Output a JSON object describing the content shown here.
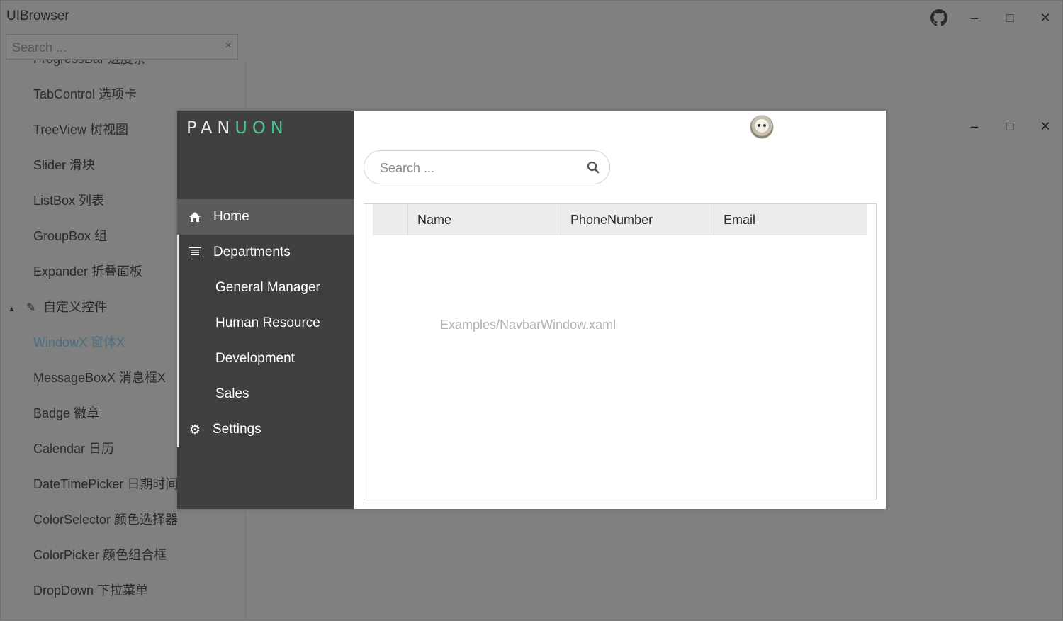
{
  "app": {
    "title": "UIBrowser",
    "controls": {
      "minimize": "–",
      "maximize": "□",
      "close": "✕"
    }
  },
  "sidebar": {
    "search_placeholder": "Search ...",
    "clear": "×",
    "items": [
      {
        "label": "TabControl 选项卡"
      },
      {
        "label": "TreeView 树视图"
      },
      {
        "label": "Slider 滑块"
      },
      {
        "label": "ListBox 列表"
      },
      {
        "label": "GroupBox 组"
      },
      {
        "label": "Expander 折叠面板"
      }
    ],
    "group": {
      "label": "自定义控件",
      "expander": "◢",
      "icon": "pencil-icon"
    },
    "group_items": [
      {
        "label": "WindowX 窗体X",
        "active": true
      },
      {
        "label": "MessageBoxX 消息框X"
      },
      {
        "label": "Badge 徽章"
      },
      {
        "label": "Calendar 日历"
      },
      {
        "label": "DateTimePicker 日期时间"
      },
      {
        "label": "ColorSelector 颜色选择器"
      },
      {
        "label": "ColorPicker 颜色组合框"
      },
      {
        "label": "DropDown 下拉菜单"
      }
    ],
    "active_color": "#4a6f80"
  },
  "window": {
    "logo_a": "PAN",
    "logo_b": "UON",
    "logo_color": "#4cc38b",
    "nav": [
      {
        "label": "Home",
        "icon": "home-icon",
        "glyph": "⌂",
        "selected": true
      },
      {
        "label": "Departments",
        "icon": "list-icon",
        "glyph": "▤"
      },
      {
        "label": "General Manager",
        "sub": true
      },
      {
        "label": "Human Resource",
        "sub": true
      },
      {
        "label": "Development",
        "sub": true
      },
      {
        "label": "Sales",
        "sub": true
      },
      {
        "label": "Settings",
        "icon": "gear-icon",
        "glyph": "⚙"
      }
    ],
    "controls": {
      "minimize": "–",
      "maximize": "□",
      "close": "✕"
    },
    "search_placeholder": "Search ...",
    "grid": {
      "columns": [
        "Name",
        "PhoneNumber",
        "Email"
      ],
      "empty_text": "Examples/NavbarWindow.xaml"
    }
  }
}
